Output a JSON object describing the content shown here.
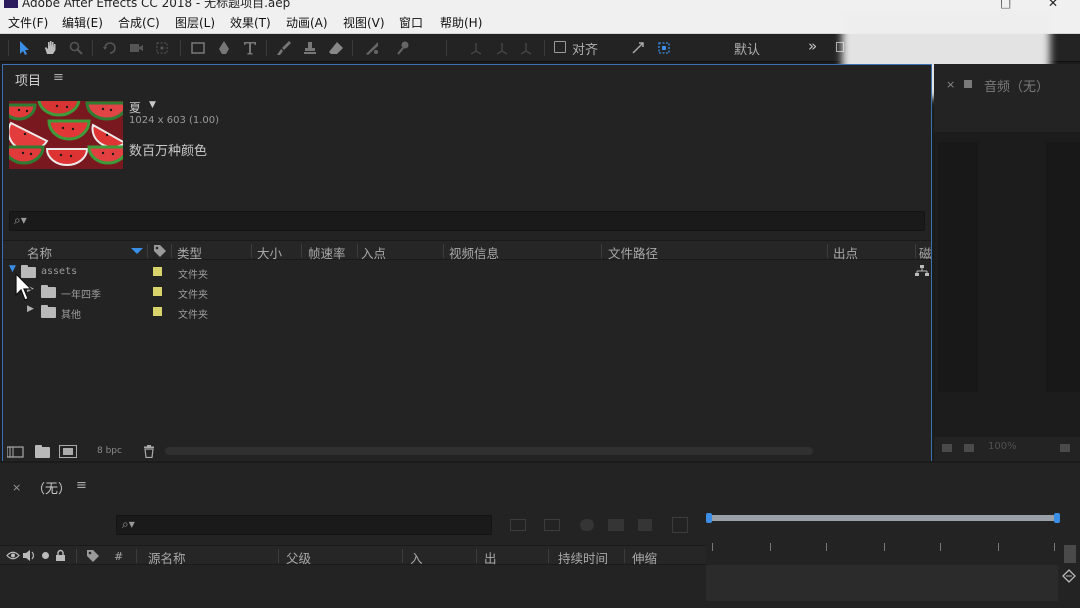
{
  "window": {
    "title": "Adobe After Effects CC 2018 - 无标题项目.aep"
  },
  "menu": [
    "文件(F)",
    "编辑(E)",
    "合成(C)",
    "图层(L)",
    "效果(T)",
    "动画(A)",
    "视图(V)",
    "窗口",
    "帮助(H)"
  ],
  "toolbar": {
    "snap_label": "对齐",
    "workspace_label": "默认",
    "more": "»"
  },
  "project": {
    "tab_label": "项目",
    "tab_menu": "≡",
    "preview": {
      "name": "夏",
      "dropdown": "▼",
      "dimensions": "1024 x 603 (1.00)",
      "colors": "数百万种颜色"
    },
    "search_icon": "⌕▾",
    "columns": [
      "名称",
      "类型",
      "大小",
      "帧速率",
      "入点",
      "视频信息",
      "文件路径",
      "出点",
      "磁"
    ],
    "rows": [
      {
        "expander": "▼",
        "name": "assets",
        "type": "文件夹"
      },
      {
        "expander": "▶",
        "name": "一年四季",
        "type": "文件夹"
      },
      {
        "expander": "▶",
        "name": "其他",
        "type": "文件夹"
      }
    ],
    "footer": {
      "bpc": "8 bpc"
    }
  },
  "right_panel": {
    "close": "×",
    "tab_label": "音频（无）",
    "zoom": "100%"
  },
  "timeline": {
    "close": "×",
    "tab_label": "（无）",
    "tab_menu": "≡",
    "search_icon": "⌕▾",
    "columns": [
      "#",
      "源名称",
      "父级",
      "入",
      "出",
      "持续时间",
      "伸缩"
    ]
  },
  "colors": {
    "accent_blue": "#3d6fb4",
    "label_yellow": "#d9d36c",
    "panel_bg": "#232323"
  }
}
